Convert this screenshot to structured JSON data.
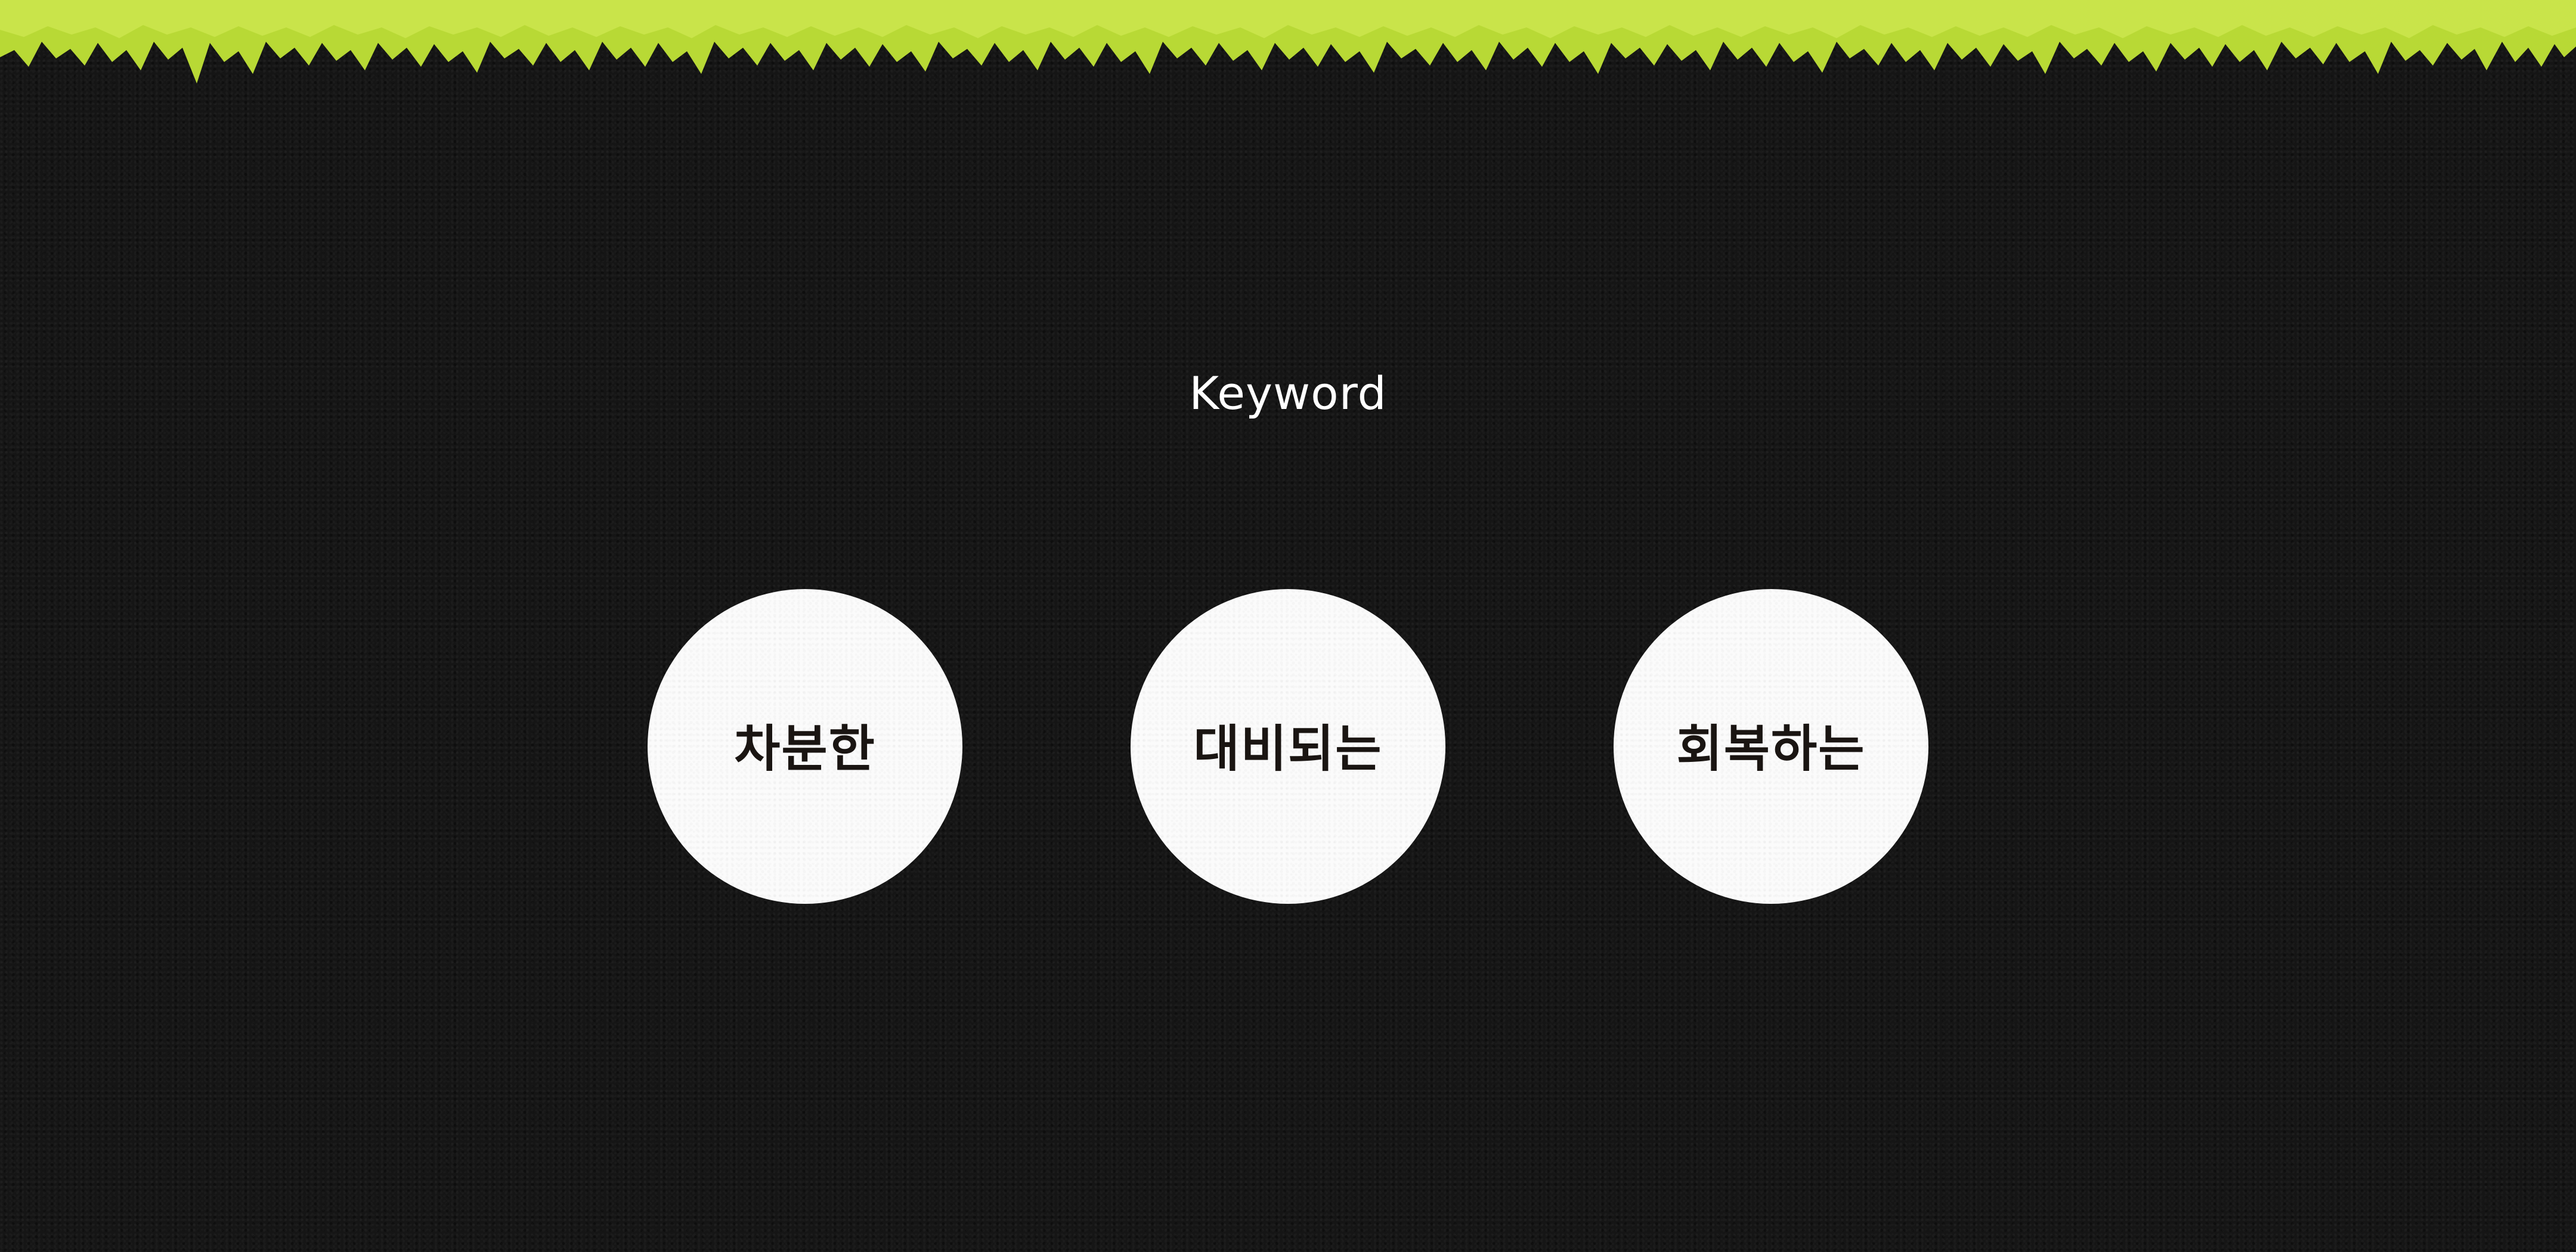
{
  "section": {
    "title": "Keyword"
  },
  "keywords": [
    {
      "label": "차분한"
    },
    {
      "label": "대비되는"
    },
    {
      "label": "회복하는"
    }
  ],
  "colors": {
    "background": "#151515",
    "grass": "#b8d935",
    "circle": "#fbfbfb",
    "keyword_text": "#1a1512",
    "title_text": "#ffffff"
  }
}
